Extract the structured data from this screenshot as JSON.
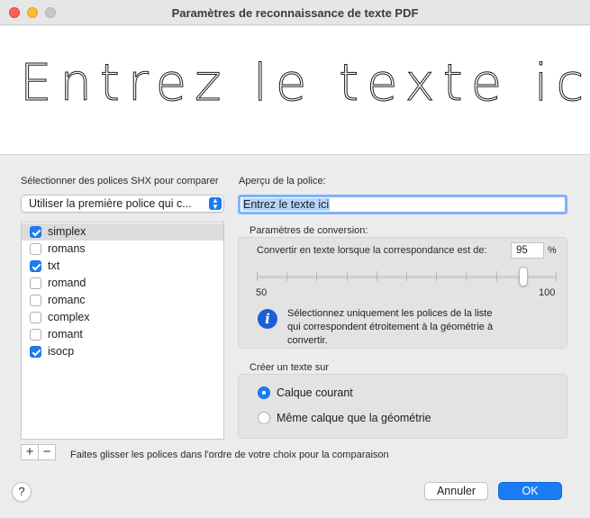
{
  "window": {
    "title": "Paramètres de reconnaissance de texte PDF"
  },
  "preview": {
    "text": "Entrez le texte ici"
  },
  "fonts": {
    "label": "Sélectionner des polices SHX pour comparer",
    "dropdown_value": "Utiliser la première police qui c...",
    "items": [
      {
        "name": "simplex",
        "checked": true,
        "selected": true
      },
      {
        "name": "romans",
        "checked": false,
        "selected": false
      },
      {
        "name": "txt",
        "checked": true,
        "selected": false
      },
      {
        "name": "romand",
        "checked": false,
        "selected": false
      },
      {
        "name": "romanc",
        "checked": false,
        "selected": false
      },
      {
        "name": "complex",
        "checked": false,
        "selected": false
      },
      {
        "name": "romant",
        "checked": false,
        "selected": false
      },
      {
        "name": "isocp",
        "checked": true,
        "selected": false
      }
    ],
    "add_symbol": "+",
    "remove_symbol": "−",
    "drag_hint": "Faites glisser les polices dans l'ordre de votre choix pour la comparaison"
  },
  "font_preview": {
    "label": "Aperçu de la police:",
    "input_value": "Entrez le texte ici"
  },
  "conversion": {
    "label": "Paramètres de conversion:",
    "match_label": "Convertir en texte lorsque la correspondance est de:",
    "match_value": "95",
    "unit": "%",
    "slider_min": "50",
    "slider_max": "100",
    "slider_value": 95,
    "info_icon": "info-icon",
    "info_text_lines": [
      "Sélectionnez uniquement les polices de la liste",
      "qui correspondent étroitement à la géométrie à",
      "convertir."
    ]
  },
  "create_text": {
    "label": "Créer un texte sur",
    "options": [
      {
        "label": "Calque courant",
        "selected": true
      },
      {
        "label": "Même calque que la géométrie",
        "selected": false
      }
    ]
  },
  "footer": {
    "help_symbol": "?",
    "cancel_label": "Annuler",
    "ok_label": "OK"
  },
  "colors": {
    "accent": "#1a7cf5",
    "info": "#1a5ed8"
  }
}
